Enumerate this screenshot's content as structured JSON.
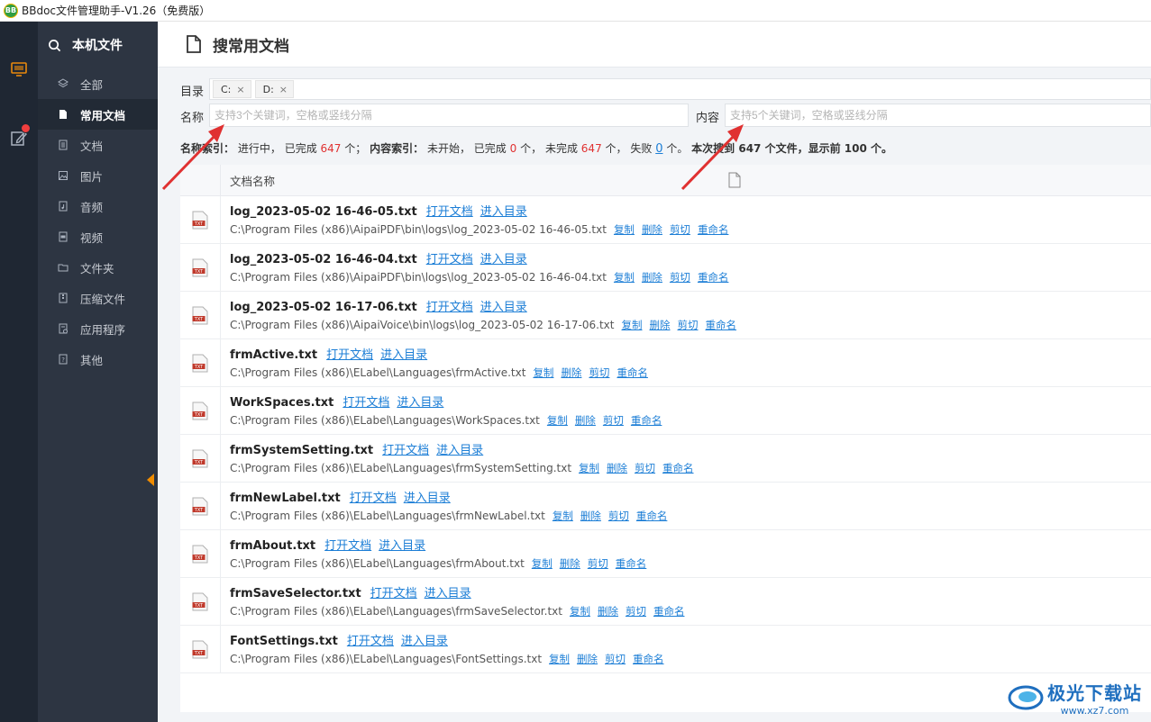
{
  "window": {
    "title": "BBdoc文件管理助手-V1.26（免费版）",
    "logo": "BB"
  },
  "rail": {
    "items": [
      {
        "icon": "monitor-icon"
      },
      {
        "icon": "edit-icon",
        "badge_color": "#f03e3e"
      }
    ]
  },
  "sidebar": {
    "header": "本机文件",
    "items": [
      {
        "label": "全部",
        "icon": "layers-icon",
        "active": false
      },
      {
        "label": "常用文档",
        "icon": "document-icon",
        "active": true
      },
      {
        "label": "文档",
        "icon": "doc-icon",
        "active": false
      },
      {
        "label": "图片",
        "icon": "image-icon",
        "active": false
      },
      {
        "label": "音频",
        "icon": "audio-icon",
        "active": false
      },
      {
        "label": "视频",
        "icon": "video-icon",
        "active": false
      },
      {
        "label": "文件夹",
        "icon": "folder-icon",
        "active": false
      },
      {
        "label": "压缩文件",
        "icon": "archive-icon",
        "active": false
      },
      {
        "label": "应用程序",
        "icon": "app-icon",
        "active": false
      },
      {
        "label": "其他",
        "icon": "other-icon",
        "active": false
      }
    ]
  },
  "page": {
    "title": "搜常用文档"
  },
  "filters": {
    "dir_label": "目录",
    "dirs": [
      {
        "label": "C:",
        "remove": "×"
      },
      {
        "label": "D:",
        "remove": "×"
      }
    ],
    "name_label": "名称",
    "name_placeholder": "支持3个关键词，空格或竖线分隔",
    "name_value": "",
    "content_label": "内容",
    "content_placeholder": "支持5个关键词，空格或竖线分隔",
    "content_value": ""
  },
  "status": {
    "name_index_label": "名称索引：",
    "name_index_state": "进行中，",
    "done_label": "已完成",
    "name_done": "647",
    "name_done_suffix": "个；",
    "content_index_label": "内容索引：",
    "content_index_state": "未开始，",
    "content_done_label": "已完成",
    "content_done": "0",
    "unit1": "个，",
    "undone_label": "未完成",
    "undone": "647",
    "unit2": "个，",
    "failed_label": "失败",
    "failed": "0",
    "unit3": "个。",
    "summary": "本次搜到 647 个文件，显示前 100 个。"
  },
  "table": {
    "column_name": "文档名称",
    "open_label": "打开文档",
    "enter_label": "进入目录",
    "copy_label": "复制",
    "delete_label": "删除",
    "cut_label": "剪切",
    "rename_label": "重命名",
    "rows": [
      {
        "name": "log_2023-05-02 16-46-05.txt",
        "path": "C:\\Program Files (x86)\\AipaiPDF\\bin\\logs\\log_2023-05-02 16-46-05.txt"
      },
      {
        "name": "log_2023-05-02 16-46-04.txt",
        "path": "C:\\Program Files (x86)\\AipaiPDF\\bin\\logs\\log_2023-05-02 16-46-04.txt"
      },
      {
        "name": "log_2023-05-02 16-17-06.txt",
        "path": "C:\\Program Files (x86)\\AipaiVoice\\bin\\logs\\log_2023-05-02 16-17-06.txt"
      },
      {
        "name": "frmActive.txt",
        "path": "C:\\Program Files (x86)\\ELabel\\Languages\\frmActive.txt"
      },
      {
        "name": "WorkSpaces.txt",
        "path": "C:\\Program Files (x86)\\ELabel\\Languages\\WorkSpaces.txt"
      },
      {
        "name": "frmSystemSetting.txt",
        "path": "C:\\Program Files (x86)\\ELabel\\Languages\\frmSystemSetting.txt"
      },
      {
        "name": "frmNewLabel.txt",
        "path": "C:\\Program Files (x86)\\ELabel\\Languages\\frmNewLabel.txt"
      },
      {
        "name": "frmAbout.txt",
        "path": "C:\\Program Files (x86)\\ELabel\\Languages\\frmAbout.txt"
      },
      {
        "name": "frmSaveSelector.txt",
        "path": "C:\\Program Files (x86)\\ELabel\\Languages\\frmSaveSelector.txt"
      },
      {
        "name": "FontSettings.txt",
        "path": "C:\\Program Files (x86)\\ELabel\\Languages\\FontSettings.txt"
      }
    ],
    "file_icon_label": "TXT"
  },
  "watermark": {
    "title": "极光下载站",
    "sub": "www.xz7.com"
  },
  "colors": {
    "rail": "#1f2733",
    "sidebar": "#2d3542",
    "link": "#1c7ed6",
    "red": "#e03131",
    "arrow": "#e03131"
  }
}
